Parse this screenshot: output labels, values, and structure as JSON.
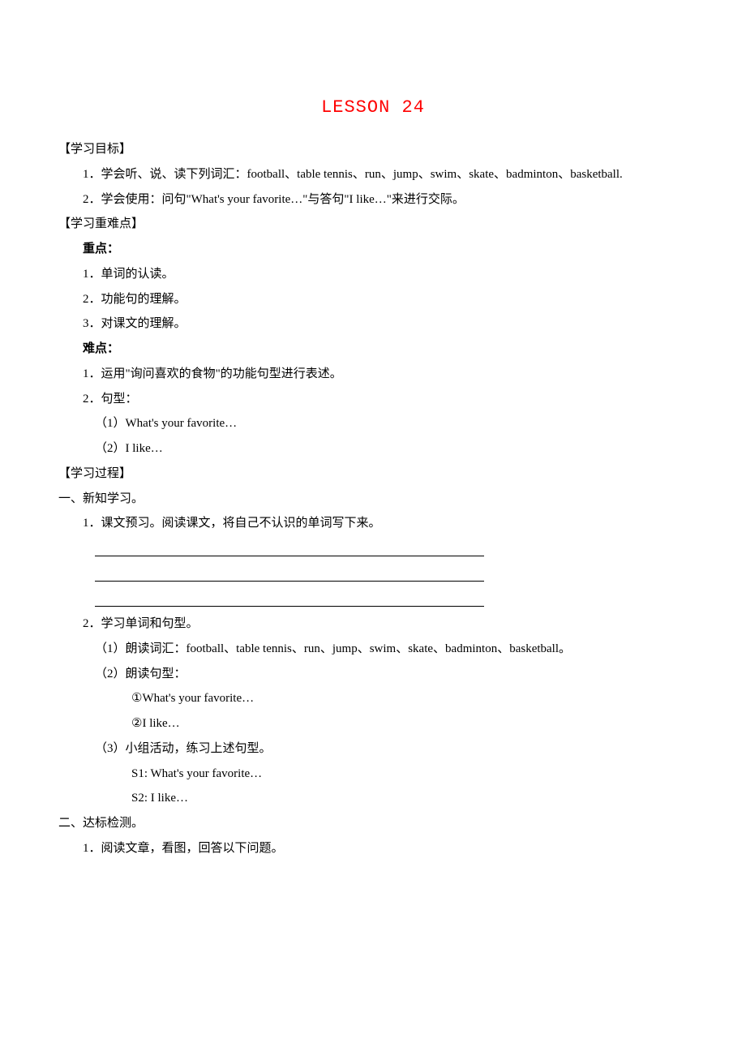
{
  "title": "LESSON 24",
  "sections": {
    "objectives": {
      "header": "【学习目标】",
      "items": [
        "1．学会听、说、读下列词汇：football、table tennis、run、jump、swim、skate、badminton、basketball.",
        "2．学会使用：问句\"What's your favorite…\"与答句\"I like…\"来进行交际。"
      ]
    },
    "keypoints": {
      "header": "【学习重难点】",
      "zhongdian_label": "重点：",
      "zhongdian_items": [
        "1．单词的认读。",
        "2．功能句的理解。",
        "3．对课文的理解。"
      ],
      "nandian_label": "难点：",
      "nandian_items": [
        "1．运用\"询问喜欢的食物\"的功能句型进行表述。",
        "2．句型："
      ],
      "nandian_sub": [
        "（1）What's your favorite…",
        "（2）I like…"
      ]
    },
    "process": {
      "header": "【学习过程】",
      "part1_label": "一、新知学习。",
      "part1_item1": "1．课文预习。阅读课文，将自己不认识的单词写下来。",
      "part1_item2": "2．学习单词和句型。",
      "part1_sub": [
        "（1）朗读词汇：football、table tennis、run、jump、swim、skate、badminton、basketball。",
        "（2）朗读句型："
      ],
      "part1_sub2": [
        "①What's your favorite…",
        "②I like…"
      ],
      "part1_sub3": "（3）小组活动，练习上述句型。",
      "part1_sub3_lines": [
        "S1: What's your favorite…",
        "S2: I like…"
      ],
      "part2_label": "二、达标检测。",
      "part2_item1": "1．阅读文章，看图，回答以下问题。"
    }
  }
}
